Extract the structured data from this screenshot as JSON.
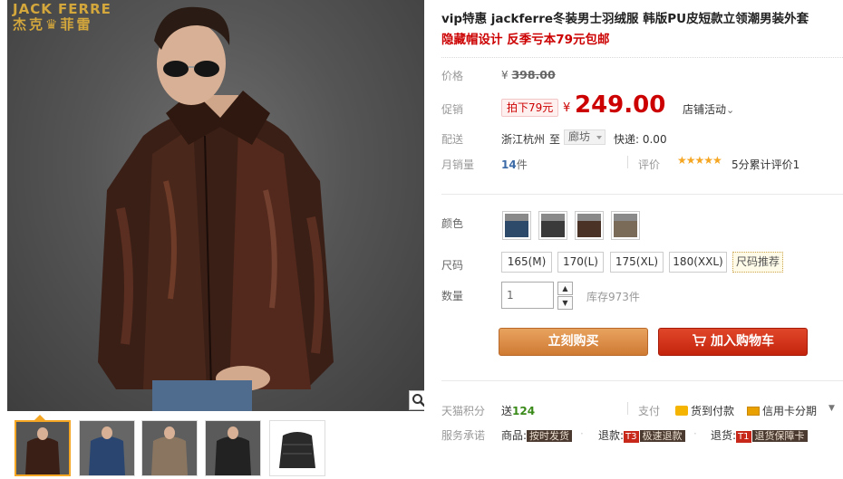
{
  "brand": {
    "logo_en": "JACK FERRE",
    "logo_cn": "杰克♛菲雷"
  },
  "product": {
    "title": "vip特惠 jackferre冬装男士羽绒服 韩版PU皮短款立领潮男装外套",
    "subtitle": "隐藏帽设计 反季亏本79元包邮"
  },
  "price": {
    "label": "价格",
    "currency": "¥",
    "original": "398.00"
  },
  "promo": {
    "label": "促销",
    "tag": "拍下79元",
    "currency": "¥",
    "price": "249.00",
    "store_activity": "店铺活动",
    "store_activity_arrow": "⌄"
  },
  "shipping": {
    "label": "配送",
    "from": "浙江杭州",
    "to_word": "至",
    "city": "廊坊",
    "express": "快递: 0.00"
  },
  "sales": {
    "label": "月销量",
    "count": "14",
    "unit": "件",
    "review_label": "评价",
    "stars": "★★★★★",
    "score": "5分累计评价1"
  },
  "color": {
    "label": "颜色",
    "swatches": [
      {
        "color": "#2e4a6a",
        "icon": "jacket-blue"
      },
      {
        "color": "#3a3a3a",
        "icon": "jacket-black"
      },
      {
        "color": "#4a3326",
        "icon": "jacket-brown"
      },
      {
        "color": "#7a6a58",
        "icon": "jacket-khaki"
      }
    ]
  },
  "size": {
    "label": "尺码",
    "options": [
      "165(M)",
      "170(L)",
      "175(XL)",
      "180(XXL)"
    ],
    "recommend": "尺码推荐"
  },
  "quantity": {
    "label": "数量",
    "value": "1",
    "stock": "库存973件"
  },
  "actions": {
    "buy_now": "立刻购买",
    "add_to_cart": "加入购物车"
  },
  "points": {
    "label": "天猫积分",
    "prefix": "送",
    "value": "124"
  },
  "payment": {
    "label": "支付",
    "cod": "货到付款",
    "installment": "信用卡分期",
    "arrow": "▼"
  },
  "service": {
    "label": "服务承诺",
    "goods_label": "商品:",
    "goods_tag": "按时发货",
    "refund_label": "退款:",
    "refund_badge": "T3",
    "refund_text": "极速退款",
    "return_label": "退货:",
    "return_badge": "T1",
    "return_text": "退货保障卡"
  },
  "colors": {
    "accent_red": "#cc0000",
    "buy_orange": "#d9893f",
    "cart_red": "#d0331a",
    "points_green": "#3a8a1a",
    "sales_blue": "#3b6aa7"
  }
}
